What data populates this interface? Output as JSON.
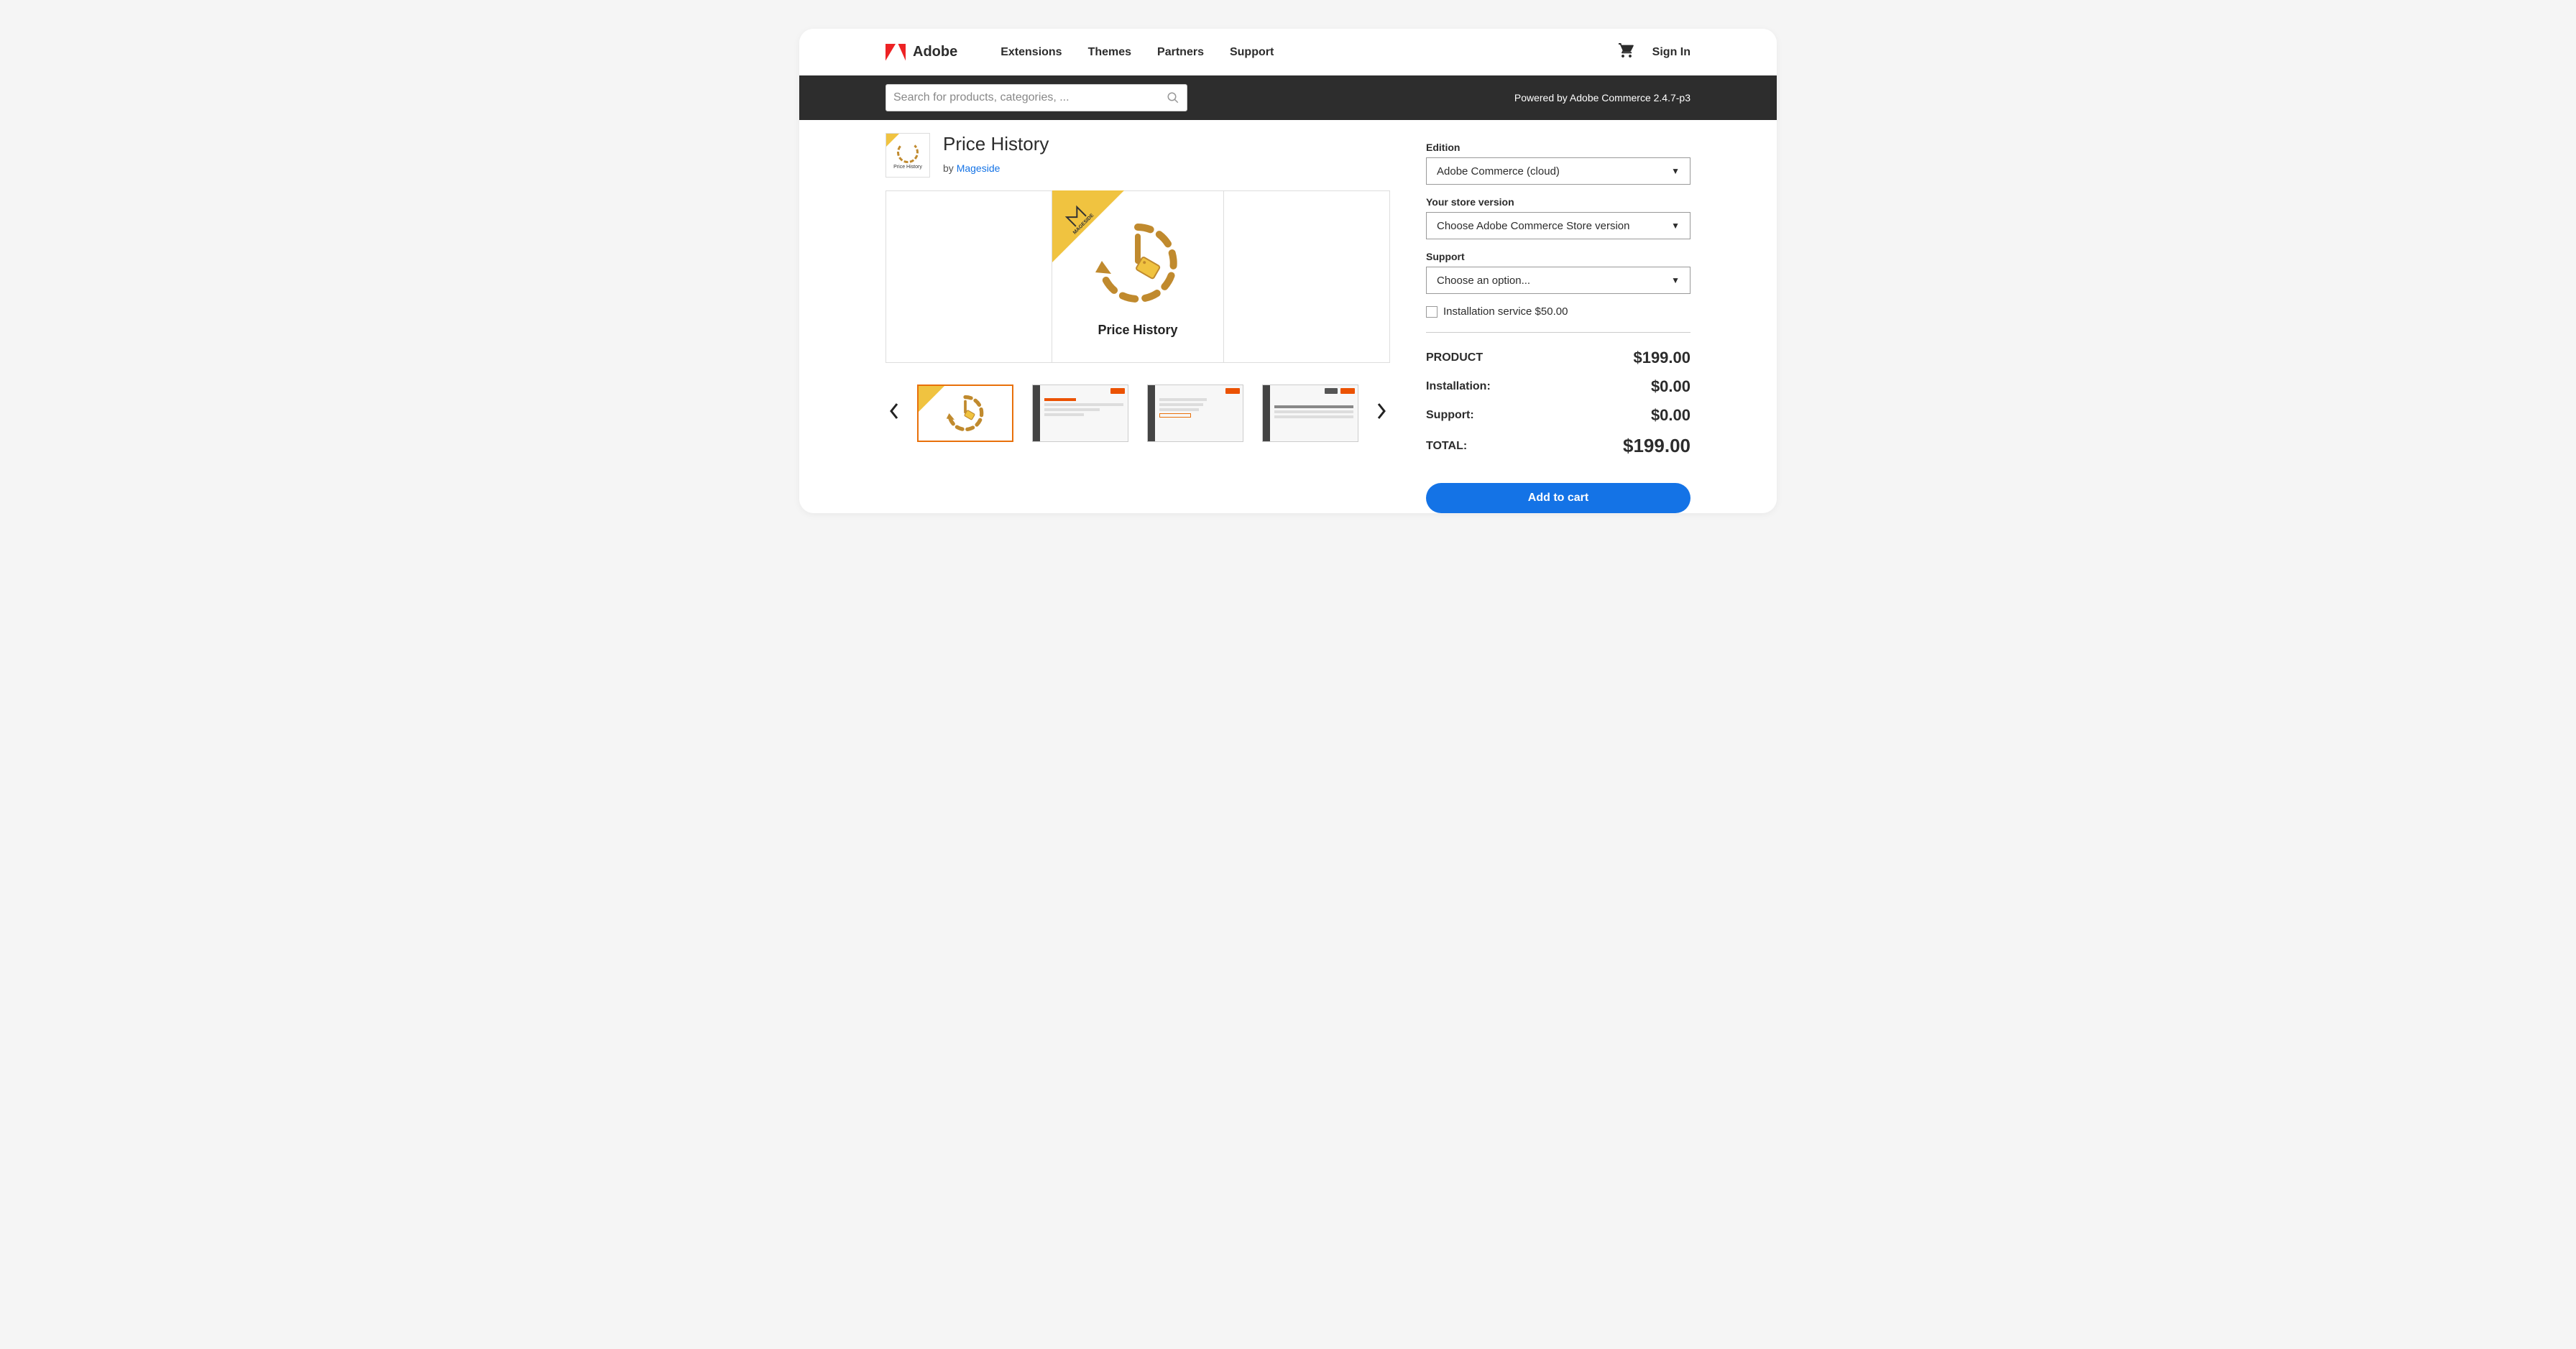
{
  "brand": {
    "name": "Adobe"
  },
  "nav": {
    "links": [
      "Extensions",
      "Themes",
      "Partners",
      "Support"
    ],
    "sign_in": "Sign In"
  },
  "search": {
    "placeholder": "Search for products, categories, ..."
  },
  "powered_by": "Powered by Adobe Commerce 2.4.7-p3",
  "product": {
    "title": "Price History",
    "by_prefix": "by ",
    "vendor": "Mageside",
    "gallery_label": "Price History",
    "thumb_label": "Price History",
    "badge": "MAGESIDE"
  },
  "form": {
    "edition_label": "Edition",
    "edition_value": "Adobe Commerce (cloud)",
    "version_label": "Your store version",
    "version_value": "Choose Adobe Commerce Store version",
    "support_label": "Support",
    "support_value": "Choose an option...",
    "install_label": "Installation service $50.00"
  },
  "pricing": {
    "product_label": "PRODUCT",
    "product_price": "$199.00",
    "install_label": "Installation:",
    "install_price": "$0.00",
    "support_label": "Support:",
    "support_price": "$0.00",
    "total_label": "TOTAL:",
    "total_price": "$199.00",
    "add_to_cart": "Add to cart"
  }
}
